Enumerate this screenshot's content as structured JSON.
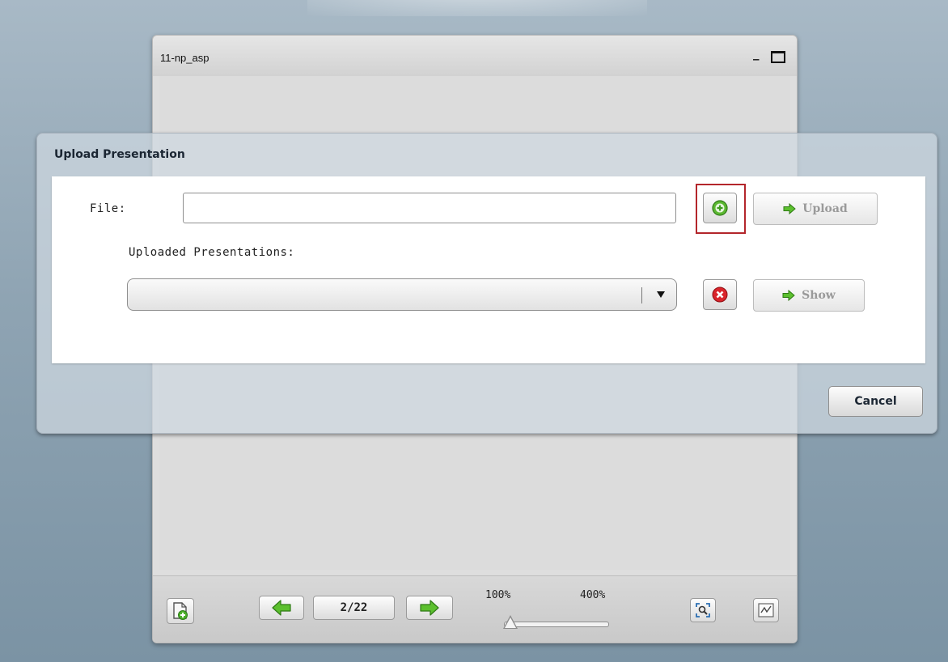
{
  "colors": {
    "accent_green": "#4caf2a",
    "delete_red": "#d9242b",
    "highlight_red": "#b3262b",
    "dialog_title": "#1b2633"
  },
  "presentation_window": {
    "title": "11-np_asp",
    "minimize_label": "_",
    "toolbar": {
      "page_indicator": "2/22",
      "zoom_min_label": "100%",
      "zoom_max_label": "400%",
      "zoom_level": 0.0,
      "icons": {
        "upload": "add-document-icon",
        "prev": "arrow-left-icon",
        "next": "arrow-right-icon",
        "fit": "zoom-fit-icon",
        "draw": "whiteboard-icon"
      }
    }
  },
  "upload_dialog": {
    "title": "Upload Presentation",
    "file_label": "File:",
    "file_value": "",
    "browse_icon": "plus-circle-icon",
    "upload_label": "Upload",
    "uploaded_label": "Uploaded Presentations:",
    "selected_presentation": "",
    "delete_icon": "remove-circle-icon",
    "show_label": "Show",
    "cancel_label": "Cancel"
  }
}
